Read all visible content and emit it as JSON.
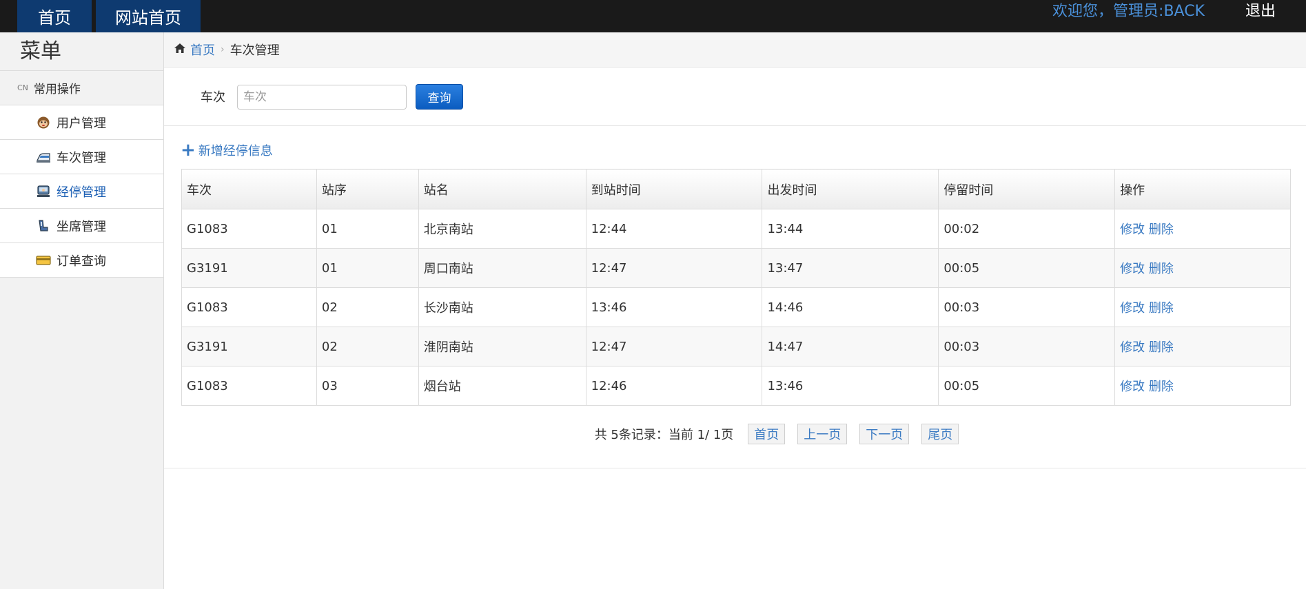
{
  "topbar": {
    "home_label": "首页",
    "site_home_label": "网站首页",
    "welcome_text": "欢迎您，管理员:BACK",
    "logout_label": "退出"
  },
  "sidebar": {
    "title": "菜单",
    "section": {
      "prefix": "CN",
      "label": "常用操作"
    },
    "items": [
      {
        "label": "用户管理",
        "icon": "monkey-face-icon"
      },
      {
        "label": "车次管理",
        "icon": "train-icon"
      },
      {
        "label": "经停管理",
        "icon": "station-icon",
        "active": true
      },
      {
        "label": "坐席管理",
        "icon": "seat-icon"
      },
      {
        "label": "订单查询",
        "icon": "card-icon"
      }
    ]
  },
  "breadcrumb": {
    "home": "首页",
    "current": "车次管理"
  },
  "search": {
    "label": "车次",
    "placeholder": "车次",
    "button_label": "查询"
  },
  "add_link": "新增经停信息",
  "table": {
    "headers": [
      "车次",
      "站序",
      "站名",
      "到站时间",
      "出发时间",
      "停留时间",
      "操作"
    ],
    "rows": [
      [
        "G1083",
        "01",
        "北京南站",
        "12:44",
        "13:44",
        "00:02"
      ],
      [
        "G3191",
        "01",
        "周口南站",
        "12:47",
        "13:47",
        "00:05"
      ],
      [
        "G1083",
        "02",
        "长沙南站",
        "13:46",
        "14:46",
        "00:03"
      ],
      [
        "G3191",
        "02",
        "淮阴南站",
        "12:47",
        "14:47",
        "00:03"
      ],
      [
        "G1083",
        "03",
        "烟台站",
        "12:46",
        "13:46",
        "00:05"
      ]
    ],
    "edit_label": "修改",
    "delete_label": "删除"
  },
  "pagination": {
    "info": "共 5条记录：当前 1/ 1页",
    "first": "首页",
    "prev": "上一页",
    "next": "下一页",
    "last": "尾页"
  },
  "colors": {
    "topbar_bg": "#1a1a1a",
    "nav_bg": "#0e3a70",
    "accent": "#3a7ac2",
    "button": "#0b5cc0"
  }
}
